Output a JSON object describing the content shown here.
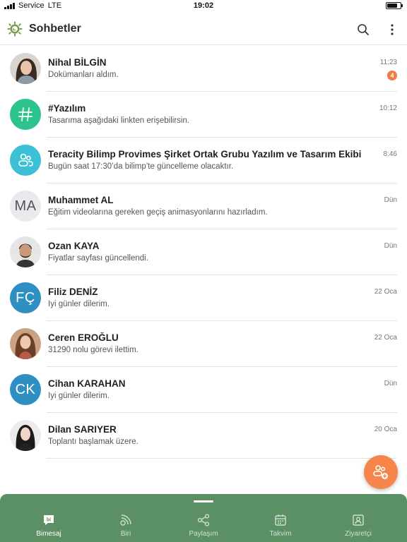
{
  "status_bar": {
    "carrier": "Service",
    "network": "LTE",
    "time": "19:02"
  },
  "header": {
    "title": "Sohbetler"
  },
  "chats": [
    {
      "name": "Nihal BİLGİN",
      "message": "Dokümanları aldım.",
      "time": "11:23",
      "unread": "4",
      "avatar": "photo"
    },
    {
      "name": "#Yazılım",
      "message": "Tasarıma aşağıdaki linkten erişebilirsin.",
      "time": "10:12",
      "avatar": "hash",
      "color": "#2cc48c"
    },
    {
      "name": "Teracity Bilimp Provimes Şirket Ortak Grubu Yazılım ve Tasarım Ekibi",
      "message": "Bugün saat 17:30’da bilimp’te güncelleme olacaktır.",
      "time": "8:46",
      "avatar": "group",
      "color": "#3cc0d6"
    },
    {
      "name": "Muhammet AL",
      "message": "Eğitim videolarına gereken geçiş animasyonlarını hazırladım.",
      "time": "Dün",
      "avatar": "initials",
      "initials": "MA",
      "color": "#e9eaee",
      "text_color": "#555555"
    },
    {
      "name": "Ozan KAYA",
      "message": "Fiyatlar sayfası güncellendi.",
      "time": "Dün",
      "avatar": "photo"
    },
    {
      "name": "Filiz DENİZ",
      "message": "İyi günler dilerim.",
      "time": "22 Oca",
      "avatar": "initials",
      "initials": "FÇ",
      "color": "#2e8fc2"
    },
    {
      "name": "Ceren EROĞLU",
      "message": "31290 nolu görevi ilettim.",
      "time": "22 Oca",
      "avatar": "photo"
    },
    {
      "name": "Cihan KARAHAN",
      "message": "İyi günler dilerim.",
      "time": "Dün",
      "avatar": "initials",
      "initials": "CK",
      "color": "#2e8fc2"
    },
    {
      "name": "Dilan SARIYER",
      "message": "Toplantı başlamak üzere.",
      "time": "20 Oca",
      "avatar": "photo"
    }
  ],
  "bottom_nav": [
    {
      "label": "Bimesaj",
      "icon": "bimesaj-icon",
      "active": true
    },
    {
      "label": "Biri",
      "icon": "biri-icon"
    },
    {
      "label": "Paylaşım",
      "icon": "share-icon"
    },
    {
      "label": "Takvim",
      "icon": "calendar-icon"
    },
    {
      "label": "Ziyaretçi",
      "icon": "visitor-icon"
    }
  ],
  "colors": {
    "accent": "#5b8f64",
    "badge": "#f07a3f",
    "fab": "#f5854a"
  }
}
